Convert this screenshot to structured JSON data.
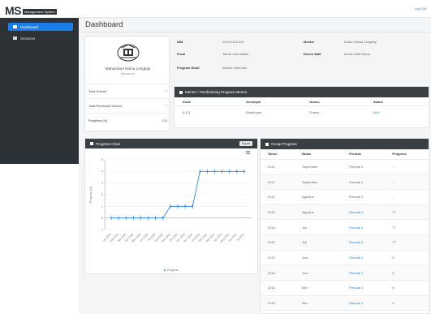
{
  "brand": {
    "logo": "MS",
    "subtitle": "Management System"
  },
  "sidebar": {
    "items": [
      {
        "label": "Dashboard",
        "icon": "dashboard-icon",
        "active": true
      },
      {
        "label": "Sessions",
        "icon": "list-icon",
        "active": false
      }
    ]
  },
  "topbar": {
    "link": "Log Out"
  },
  "page": {
    "title": "Dashboard"
  },
  "profile": {
    "name": "Mahasiswa Nama Lengkap",
    "role": "Mahasiswa",
    "stats": [
      {
        "label": "Total Submit",
        "value": "7",
        "blue": false
      },
      {
        "label": "Total Reviewed Submit",
        "value": "7",
        "blue": false
      },
      {
        "label": "Progress (%)",
        "value": "100",
        "blue": true
      }
    ]
  },
  "info": {
    "nim_label": "NIM",
    "nim_value": "2016 4402 001",
    "prodi_label": "Prodi",
    "prodi_value": "Teknik Informatika",
    "status_label": "Program Studi",
    "status_value": "Sistem Informasi",
    "mentor_label": "Mentor",
    "mentor_value": "Dosen Nama Lengkap",
    "dosen_label": "Dosen Wali",
    "dosen_value": "Dosen Wali Nama"
  },
  "mentor_panel": {
    "title": "Mentor / Pembimbing Program Mentor",
    "columns": [
      "Kode",
      "Deskripsi",
      "Dosen",
      "Status"
    ],
    "rows": [
      {
        "kode": "A.S.1",
        "desc": "Bimbingan",
        "dosen": "Dosen",
        "status": "Aktif"
      }
    ]
  },
  "chart_card": {
    "title": "Progress Chart",
    "button": "Export",
    "legend": "Progress"
  },
  "chart_data": {
    "type": "line",
    "x": [
      "Jan 2018",
      "Feb 2018",
      "Mar 2018",
      "Apr 2018",
      "May 2018",
      "Jun 2018",
      "Jul 2018",
      "Aug 2018",
      "Sep 2018",
      "Oct 2018",
      "Nov 2018",
      "Dec 2018",
      "Jan 2019",
      "Feb 2019",
      "Mar 2019",
      "Apr 2019",
      "May 2019",
      "Jun 2019",
      "Jul 2019"
    ],
    "series": [
      {
        "name": "Progress",
        "values": [
          0,
          0,
          0,
          0,
          0,
          0,
          0,
          0,
          1,
          1,
          1,
          1,
          4,
          4,
          4,
          4,
          4,
          4,
          4
        ]
      }
    ],
    "ylim": [
      -1,
      5
    ],
    "yticks": [
      -1,
      0,
      1,
      2,
      3,
      4,
      5
    ],
    "ylabel": "Progress (%)",
    "color": "#1a7ce6"
  },
  "progress_table": {
    "title": "Group Progress",
    "columns": [
      "Tahun",
      "Bulan",
      "Periode",
      "Progress"
    ],
    "rows": [
      {
        "tahun": "2017",
        "bulan": "September",
        "periode": "Periode 1",
        "progress": "..."
      },
      {
        "tahun": "2017",
        "bulan": "September",
        "periode": "Periode 1",
        "progress": "..."
      },
      {
        "tahun": "2017",
        "bulan": "Agustus",
        "periode": "Periode 1",
        "progress": "..."
      },
      {
        "tahun": "2015",
        "bulan": "Agustus",
        "periode": "Periode 1",
        "progress": "77"
      },
      {
        "tahun": "2015",
        "bulan": "Juli",
        "periode": "Periode 2",
        "progress": "77"
      },
      {
        "tahun": "2017",
        "bulan": "Juli",
        "periode": "Periode 1",
        "progress": "77"
      },
      {
        "tahun": "2017",
        "bulan": "Juni",
        "periode": "Periode 1",
        "progress": "0"
      },
      {
        "tahun": "2015",
        "bulan": "Juni",
        "periode": "Periode 1",
        "progress": "0"
      },
      {
        "tahun": "2015",
        "bulan": "Mei",
        "periode": "Periode 1",
        "progress": "0"
      },
      {
        "tahun": "2015",
        "bulan": "Mei",
        "periode": "Periode 1",
        "progress": "0"
      },
      {
        "tahun": "2015",
        "bulan": "April",
        "periode": "Periode 2",
        "progress": "0"
      }
    ]
  }
}
